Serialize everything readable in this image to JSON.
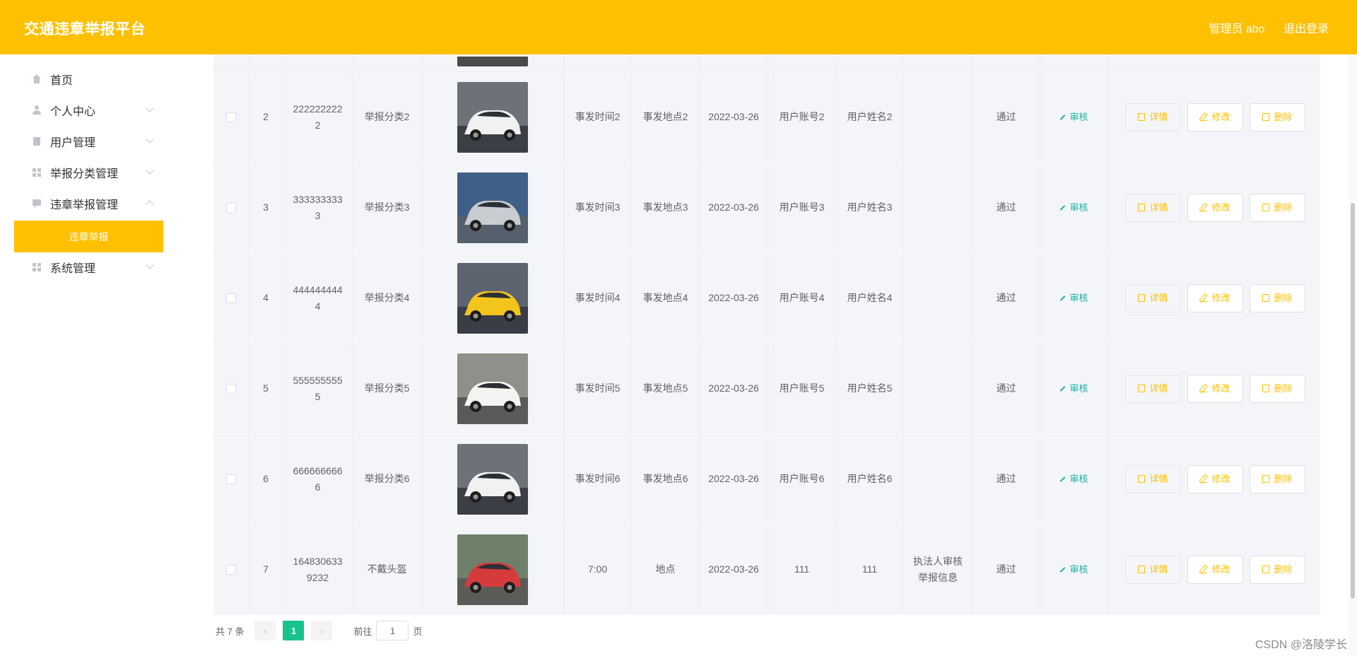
{
  "header": {
    "title": "交通违章举报平台",
    "admin": "管理员 abo",
    "logout": "退出登录"
  },
  "sidebar": {
    "items": [
      {
        "label": "首页",
        "icon": "home-icon"
      },
      {
        "label": "个人中心",
        "icon": "user-icon"
      },
      {
        "label": "用户管理",
        "icon": "clipboard-icon"
      },
      {
        "label": "举报分类管理",
        "icon": "grid-icon"
      },
      {
        "label": "违章举报管理",
        "icon": "chat-icon"
      },
      {
        "label": "系统管理",
        "icon": "grid-icon"
      }
    ],
    "active_sub": "违章举报"
  },
  "rows": [
    {
      "index": "2",
      "number": "2222222222",
      "category": "举报分类2",
      "time": "事发时间2",
      "place": "事发地点2",
      "date": "2022-03-26",
      "account": "用户账号2",
      "name": "用户姓名2",
      "reply": "",
      "status": "通过",
      "audit": "审核",
      "img": "white"
    },
    {
      "index": "3",
      "number": "3333333333",
      "category": "举报分类3",
      "time": "事发时间3",
      "place": "事发地点3",
      "date": "2022-03-26",
      "account": "用户账号3",
      "name": "用户姓名3",
      "reply": "",
      "status": "通过",
      "audit": "审核",
      "img": "silver"
    },
    {
      "index": "4",
      "number": "4444444444",
      "category": "举报分类4",
      "time": "事发时间4",
      "place": "事发地点4",
      "date": "2022-03-26",
      "account": "用户账号4",
      "name": "用户姓名4",
      "reply": "",
      "status": "通过",
      "audit": "审核",
      "img": "yellow"
    },
    {
      "index": "5",
      "number": "5555555555",
      "category": "举报分类5",
      "time": "事发时间5",
      "place": "事发地点5",
      "date": "2022-03-26",
      "account": "用户账号5",
      "name": "用户姓名5",
      "reply": "",
      "status": "通过",
      "audit": "审核",
      "img": "ae86"
    },
    {
      "index": "6",
      "number": "6666666666",
      "category": "举报分类6",
      "time": "事发时间6",
      "place": "事发地点6",
      "date": "2022-03-26",
      "account": "用户账号6",
      "name": "用户姓名6",
      "reply": "",
      "status": "通过",
      "audit": "审核",
      "img": "white"
    },
    {
      "index": "7",
      "number": "1648306339232",
      "category": "不戴头盔",
      "time": "7:00",
      "place": "地点",
      "date": "2022-03-26",
      "account": "111",
      "name": "111",
      "reply": "执法人审核举报信息",
      "status": "通过",
      "audit": "审核",
      "img": "street"
    }
  ],
  "actions": {
    "detail": "详情",
    "edit": "修改",
    "delete": "删除"
  },
  "pagination": {
    "total": "共 7 条",
    "current": "1",
    "goto_label": "前往",
    "goto_value": "1",
    "page_suffix": "页",
    "prev": "‹",
    "next": "›"
  },
  "watermark": "CSDN @洛陵学长",
  "colors": {
    "brand": "#ffc000",
    "accent": "#17c28d",
    "audit": "#17b3a3"
  }
}
